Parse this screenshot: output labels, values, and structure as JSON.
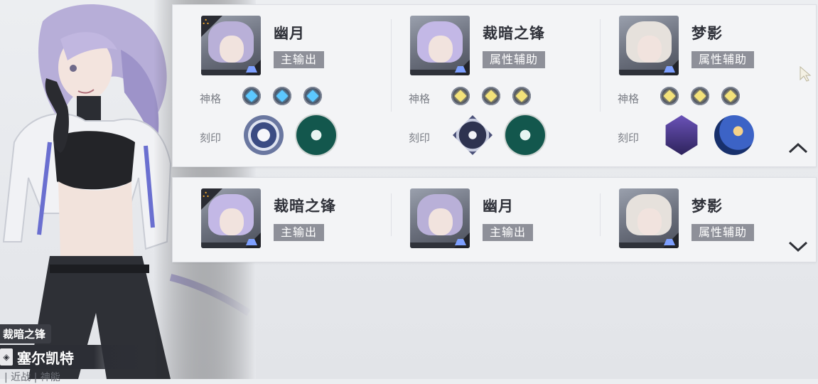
{
  "character": {
    "subtitle": "裁暗之锋",
    "name": "塞尔凯特",
    "tags": "| 近战 | 神能",
    "emblem_icon": "seal-emblem-icon"
  },
  "teams": [
    {
      "state": "expanded",
      "toggle_icon": "chevron-up-icon",
      "slots": [
        {
          "name": "幽月",
          "role": "主输出",
          "leader": true,
          "hair_color": "#b9b0d8",
          "god_label": "神格",
          "god_color": "blue",
          "seal_label": "刻印",
          "seals": [
            "compass-seal-icon",
            "swan-seal-icon"
          ]
        },
        {
          "name": "裁暗之锋",
          "role": "属性辅助",
          "leader": false,
          "hair_color": "#c3b8e6",
          "god_label": "神格",
          "god_color": "gold",
          "seal_label": "刻印",
          "seals": [
            "scorpion-seal-icon",
            "swan-seal-icon"
          ]
        },
        {
          "name": "梦影",
          "role": "属性辅助",
          "leader": false,
          "hair_color": "#e6e1dc",
          "god_label": "神格",
          "god_color": "gold",
          "seal_label": "刻印",
          "seals": [
            "gate-seal-icon",
            "orb-seal-icon"
          ]
        }
      ]
    },
    {
      "state": "collapsed",
      "toggle_icon": "chevron-down-icon",
      "slots": [
        {
          "name": "裁暗之锋",
          "role": "主输出",
          "leader": true,
          "hair_color": "#c3b8e6"
        },
        {
          "name": "幽月",
          "role": "主输出",
          "leader": false,
          "hair_color": "#b9b0d8"
        },
        {
          "name": "梦影",
          "role": "属性辅助",
          "leader": false,
          "hair_color": "#e6e1dc"
        }
      ]
    }
  ],
  "colors": {
    "leader_badge": "#f0a62c",
    "god_blue": "#5cc8ff",
    "god_gold": "#f3e27a",
    "role_tag_bg": "#8e9099"
  }
}
